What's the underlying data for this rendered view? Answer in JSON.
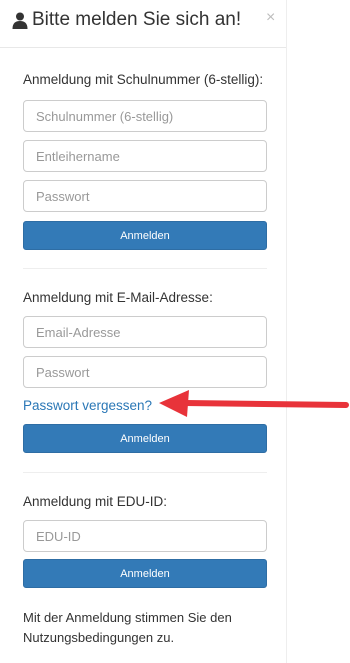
{
  "modal": {
    "title": "Bitte melden Sie sich an!",
    "close_label": "×",
    "user_icon": "user-icon"
  },
  "school_login": {
    "heading": "Anmeldung mit Schulnummer (6-stellig):",
    "school_number_placeholder": "Schulnummer (6-stellig)",
    "borrower_placeholder": "Entleihername",
    "password_placeholder": "Passwort",
    "submit_label": "Anmelden"
  },
  "email_login": {
    "heading": "Anmeldung mit E-Mail-Adresse:",
    "email_placeholder": "Email-Adresse",
    "password_placeholder": "Passwort",
    "forgot_link": "Passwort vergessen?",
    "submit_label": "Anmelden"
  },
  "edu_login": {
    "heading": "Anmeldung mit EDU-ID:",
    "edu_placeholder": "EDU-ID",
    "submit_label": "Anmelden"
  },
  "footer": {
    "terms_text": "Mit der Anmeldung stimmen Sie den Nutzungsbedingungen zu."
  },
  "colors": {
    "primary": "#337ab7",
    "link": "#2a77b6",
    "arrow": "#e8333a"
  }
}
